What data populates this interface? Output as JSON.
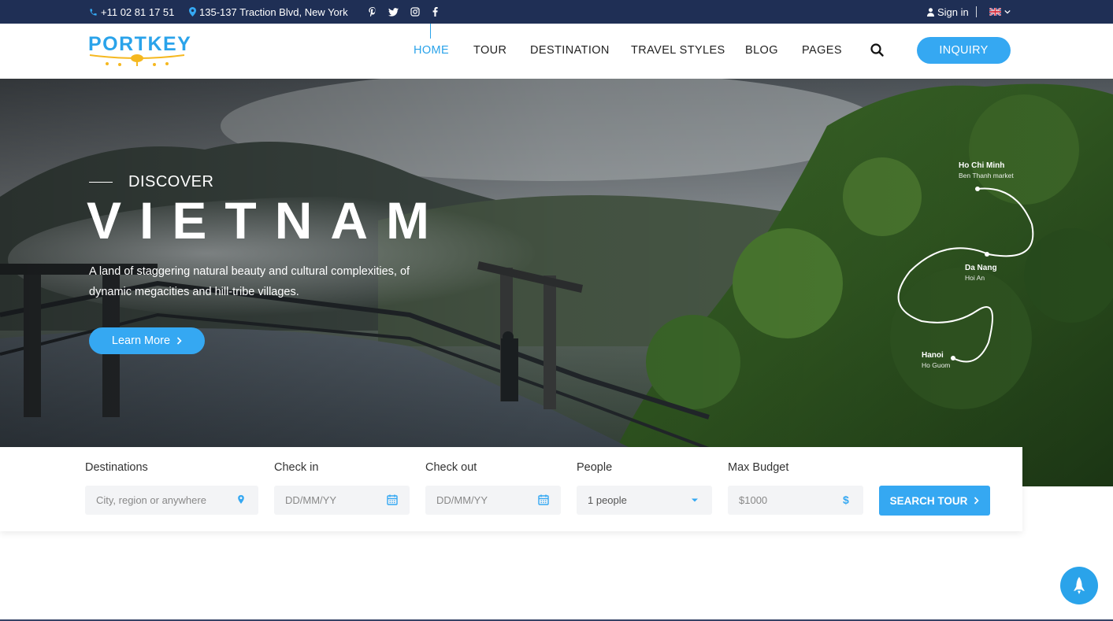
{
  "topbar": {
    "phone": "+11 02 81 17 51",
    "address": "135-137 Traction Blvd, New York",
    "social": [
      "pinterest-icon",
      "twitter-icon",
      "instagram-icon",
      "facebook-icon"
    ],
    "signin": "Sign in",
    "language_flag": "uk-flag-icon"
  },
  "header": {
    "logo_text": "PORTKEY",
    "nav": [
      {
        "label": "HOME",
        "active": true
      },
      {
        "label": "TOUR"
      },
      {
        "label": "DESTINATION"
      },
      {
        "label": "TRAVEL STYLES"
      },
      {
        "label": "BLOG"
      },
      {
        "label": "PAGES"
      }
    ],
    "inquiry_label": "INQUIRY"
  },
  "hero": {
    "kicker": "DISCOVER",
    "title": "VIETNAM",
    "description": "A land of staggering natural beauty and cultural complexities, of dynamic megacities and hill-tribe villages.",
    "cta_label": "Learn More",
    "route": [
      {
        "city": "Ho Chi Minh",
        "sub": "Ben Thanh market"
      },
      {
        "city": "Da Nang",
        "sub": "Hoi An"
      },
      {
        "city": "Hanoi",
        "sub": "Ho Guom"
      }
    ]
  },
  "search": {
    "fields": [
      {
        "label": "Destinations",
        "placeholder": "City, region or anywhere",
        "icon": "map-pin-icon"
      },
      {
        "label": "Check in",
        "placeholder": "DD/MM/YY",
        "icon": "calendar-icon"
      },
      {
        "label": "Check out",
        "placeholder": "DD/MM/YY",
        "icon": "calendar-icon"
      },
      {
        "label": "People",
        "value": "1 people",
        "icon": "caret-down-icon"
      },
      {
        "label": "Max Budget",
        "placeholder": "$1000",
        "icon": "dollar-icon"
      }
    ],
    "button_label": "SEARCH TOUR"
  },
  "colors": {
    "navy": "#1f2f55",
    "accent": "#35a8f2",
    "logo_yellow": "#f5b820"
  }
}
